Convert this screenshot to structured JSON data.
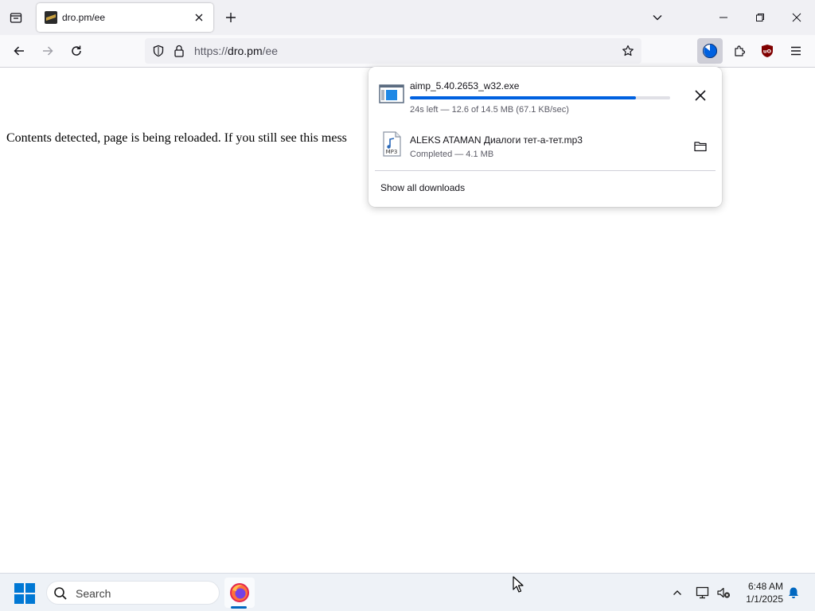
{
  "browser": {
    "tab": {
      "title": "dro.pm/ee"
    },
    "url": {
      "scheme": "https://",
      "host": "dro.pm",
      "path": "/ee"
    }
  },
  "page": {
    "message": "Contents detected, page is being reloaded. If you still see this mess"
  },
  "downloads_panel": {
    "items": [
      {
        "name": "aimp_5.40.2653_w32.exe",
        "status": "24s left — 12.6 of 14.5 MB (67.1 KB/sec)",
        "progress": 0.869,
        "icon": "exe-file-icon",
        "action": "cancel"
      },
      {
        "name": "ALEKS ATAMAN Диалоги тет-а-тет.mp3",
        "status": "Completed — 4.1 MB",
        "icon": "mp3-file-icon",
        "icon_label": "MP3",
        "action": "show-in-folder"
      }
    ],
    "show_all": "Show all downloads"
  },
  "taskbar": {
    "search_placeholder": "Search",
    "clock": {
      "time": "6:48 AM",
      "date": "1/1/2025"
    }
  },
  "colors": {
    "accent": "#0061e0",
    "windows_blue": "#0078d4",
    "ublock_red": "#800000"
  }
}
